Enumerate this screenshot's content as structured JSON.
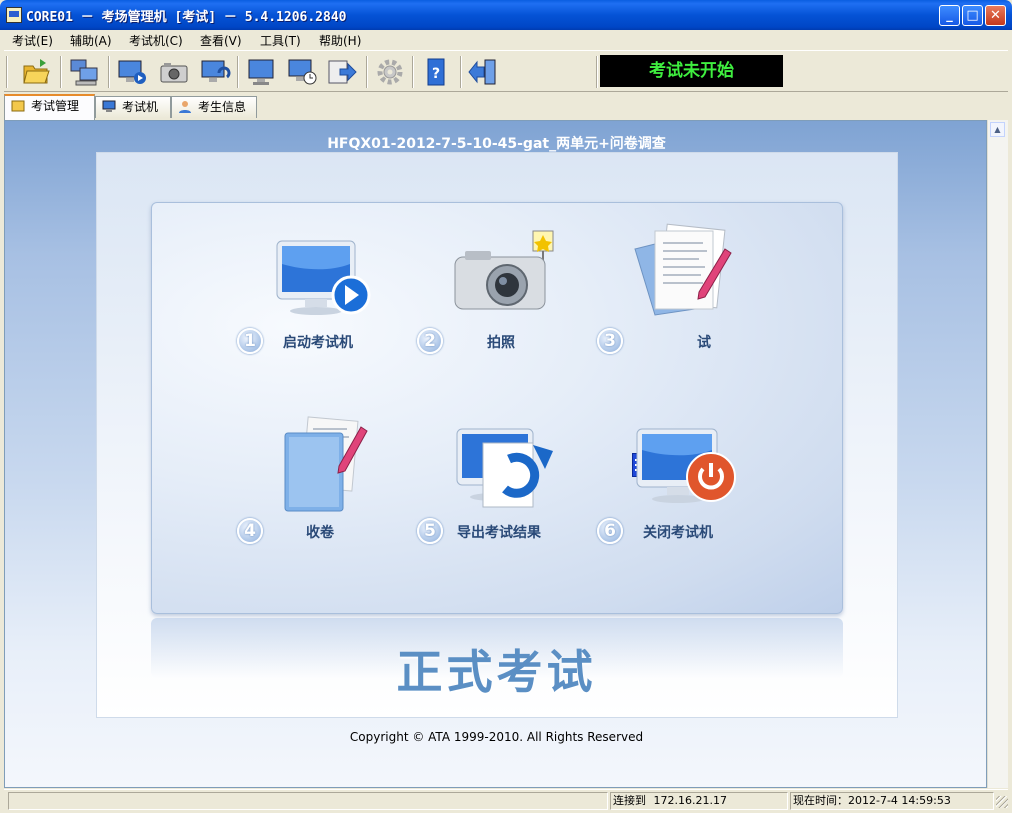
{
  "window": {
    "title": "CORE01 － 考场管理机 [考试] － 5.4.1206.2840"
  },
  "menu": [
    "考试(E)",
    "辅助(A)",
    "考试机(C)",
    "查看(V)",
    "工具(T)",
    "帮助(H)"
  ],
  "toolbar": {
    "status_text": "考试未开始",
    "buttons": [
      "open-folder-icon",
      "network-computers-icon",
      "start-monitor-icon",
      "camera-icon",
      "refresh-monitor-icon",
      "monitor-icon",
      "monitor-clock-icon",
      "export-icon",
      "gear-icon",
      "help-book-icon",
      "exit-icon"
    ]
  },
  "tabs": [
    "考试管理",
    "考试机",
    "考生信息"
  ],
  "main": {
    "exam_name": "HFQX01-2012-7-5-10-45-gat_两单元+问卷调查",
    "actions": [
      {
        "num": "1",
        "label": "启动考试机",
        "icon": "monitor-play-icon"
      },
      {
        "num": "2",
        "label": "拍照",
        "icon": "camera-icon"
      },
      {
        "num": "3",
        "label": "试",
        "icon": "paper-pen-icon"
      },
      {
        "num": "4",
        "label": "收卷",
        "icon": "folder-pen-icon"
      },
      {
        "num": "5",
        "label": "导出考试结果",
        "icon": "monitor-export-icon"
      },
      {
        "num": "6",
        "label": "关闭考试机",
        "icon": "monitor-power-icon"
      }
    ],
    "banner": "正式考试",
    "copyright": "Copyright © ATA 1999-2010. All Rights Reserved"
  },
  "statusbar": {
    "connection_label": "连接到",
    "connection_ip": "172.16.21.17",
    "time_label": "现在时间：",
    "time_value": "2012-7-4 14:59:53"
  },
  "colors": {
    "accent": "#0553d6",
    "status_text": "#3fef3f",
    "label": "#2a4a78"
  }
}
